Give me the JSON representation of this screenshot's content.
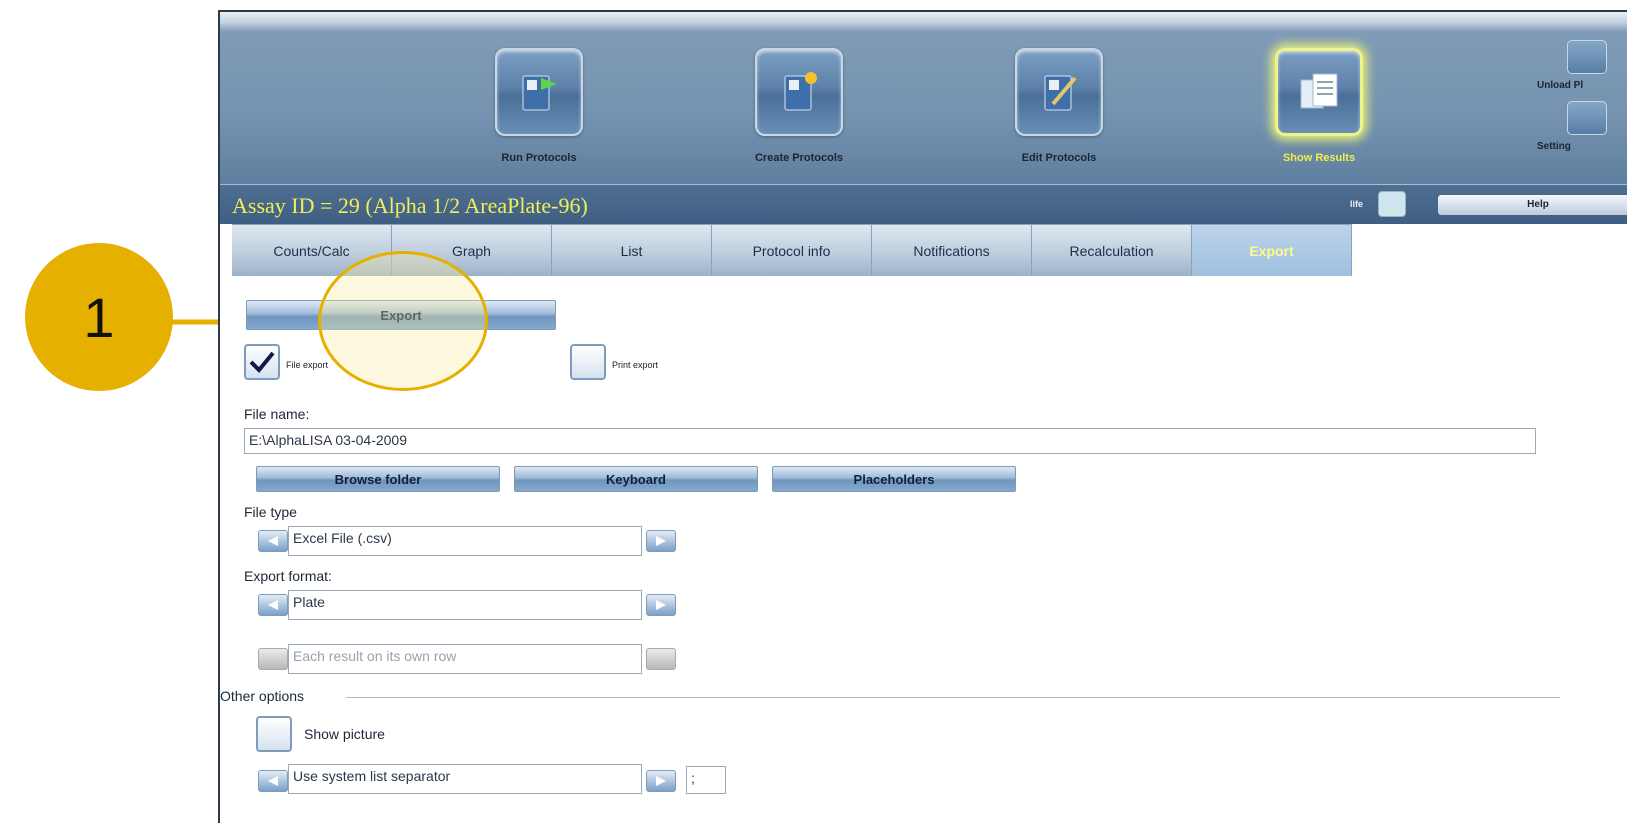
{
  "callout": {
    "number": "1"
  },
  "toolbar": {
    "tools": [
      {
        "label": "Run Protocols"
      },
      {
        "label": "Create Protocols"
      },
      {
        "label": "Edit Protocols"
      },
      {
        "label": "Show Results"
      }
    ],
    "right": {
      "unload_label": "Unload Pl",
      "settings_label": "Setting"
    }
  },
  "header": {
    "assay_title": "Assay ID = 29 (Alpha 1/2 AreaPlate-96)",
    "life_label": "life",
    "help_label": "Help"
  },
  "tabs": [
    {
      "label": "Counts/Calc"
    },
    {
      "label": "Graph"
    },
    {
      "label": "List"
    },
    {
      "label": "Protocol info"
    },
    {
      "label": "Notifications"
    },
    {
      "label": "Recalculation"
    },
    {
      "label": "Export"
    }
  ],
  "export": {
    "export_button": "Export",
    "file_export_label": "File export",
    "print_export_label": "Print export",
    "file_export_checked": true,
    "print_export_checked": false,
    "file_name_label": "File name:",
    "file_name_value": "E:\\AlphaLISA  03-04-2009",
    "browse_label": "Browse folder",
    "keyboard_label": "Keyboard",
    "placeholders_label": "Placeholders",
    "file_type_label": "File type",
    "file_type_value": "Excel File (.csv)",
    "export_format_label": "Export format:",
    "export_format_value": "Plate",
    "sub_format_value": "Each result on its own row",
    "other_options_label": "Other options",
    "show_picture_label": "Show picture",
    "separator_value": "Use system list separator",
    "separator_char": ";"
  },
  "colors": {
    "accent_yellow": "#e5b000",
    "title_yellow": "#f0ee5a",
    "toolbar_blue": "#7593b0"
  }
}
